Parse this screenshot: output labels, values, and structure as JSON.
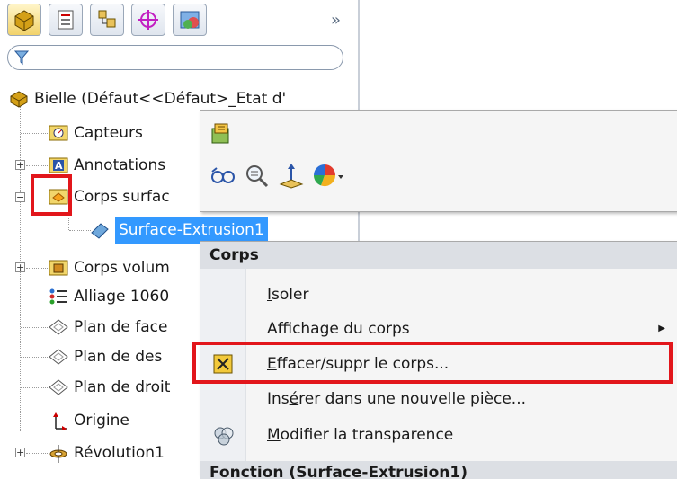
{
  "tabbar": {
    "more_label": "»"
  },
  "tree": {
    "root_label": "Bielle  (Défaut<<Défaut>_Etat d'",
    "items": [
      {
        "label": "Capteurs"
      },
      {
        "label": "Annotations"
      },
      {
        "label": "Corps surfac"
      },
      {
        "label": "Surface-Extrusion1"
      },
      {
        "label": "Corps volum"
      },
      {
        "label": "Alliage 1060"
      },
      {
        "label": "Plan de face"
      },
      {
        "label": "Plan de des"
      },
      {
        "label": "Plan de droit"
      },
      {
        "label": "Origine"
      },
      {
        "label": "Révolution1"
      }
    ]
  },
  "menu": {
    "header": "Corps",
    "items": [
      {
        "pre": "",
        "acc": "I",
        "post": "soler"
      },
      {
        "pre": "Affichage du corps",
        "acc": "",
        "post": ""
      },
      {
        "pre": "",
        "acc": "E",
        "post": "ffacer/suppr le corps..."
      },
      {
        "pre": "Ins",
        "acc": "é",
        "post": "rer dans une nouvelle pièce..."
      },
      {
        "pre": "",
        "acc": "M",
        "post": "odifier la transparence"
      }
    ],
    "footer": "Fonction (Surface-Extrusion1)"
  },
  "colors": {
    "highlight": "#e2161b",
    "selection": "#3399ff"
  }
}
